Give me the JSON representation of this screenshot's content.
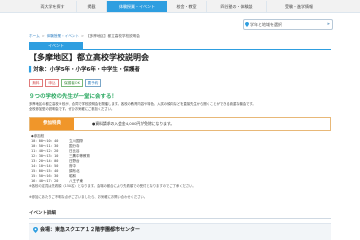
{
  "nav": {
    "items": [
      "両⼤学を探す",
      "掲載",
      "体験授業・イベント",
      "校舎・教室",
      "四谷塾の・体験談",
      "受験・進学情報"
    ]
  },
  "area_selector": {
    "label": "学年と地域を選択",
    "arrow": "▸"
  },
  "breadcrumb": {
    "items": [
      "ホーム",
      "体験授業・イベント"
    ],
    "current": "【多摩地区】都立高校学校説明会"
  },
  "event": {
    "category": "イベント",
    "title": "【多摩地区】都立高校学校説明会",
    "target": "対象：小学5年・小学6年・中学生・保護者",
    "tags": [
      "無料",
      "申込",
      "保護者OK",
      "要予約"
    ],
    "highlight": "９つの学校の先生が一堂に会する！",
    "description": [
      "多摩地区の都立高校９校が、合同で学校説明会を開催します。各校の教育内容や特色、入試の傾向などを直接先生から聞くことができる貴重な機会です。",
      "全校参加型の説明会です。ぜひお気軽にご参加ください。"
    ],
    "benefit_label": "参加特典",
    "benefit_text": "●資料請求の入会金4,000円が免除になります。",
    "schedule_heading": "◆参加校",
    "schedule": [
      {
        "time": "10：00〜10：40",
        "school": "立川国際"
      },
      {
        "time": "10：50〜11：30",
        "school": "国分寺"
      },
      {
        "time": "11：40〜12：20",
        "school": "日比谷"
      },
      {
        "time": "12：30〜13：10",
        "school": "三鷹中等教育"
      },
      {
        "time": "13：20〜14：00",
        "school": "日野台"
      },
      {
        "time": "14：10〜14：50",
        "school": "府中"
      },
      {
        "time": "15：00〜15：40",
        "school": "調布北"
      },
      {
        "time": "15：50〜16：30",
        "school": "昭和"
      },
      {
        "time": "16：40〜17：20",
        "school": "八王子東"
      }
    ],
    "note1": "※各校の定員は先着順（150名）となります。会場の都合により先着順での受付となりますのでご了承ください。",
    "note2": "※参加にあたりご不明な点がございましたら、お気軽にお問い合わせください。",
    "detail_heading": "イベント詳細",
    "venue": "会場：東急スクエア１２階学園都市センター"
  },
  "colors": {
    "accent": "#2e9ee0",
    "benefit": "#f0962a",
    "highlight": "#2aa860"
  }
}
